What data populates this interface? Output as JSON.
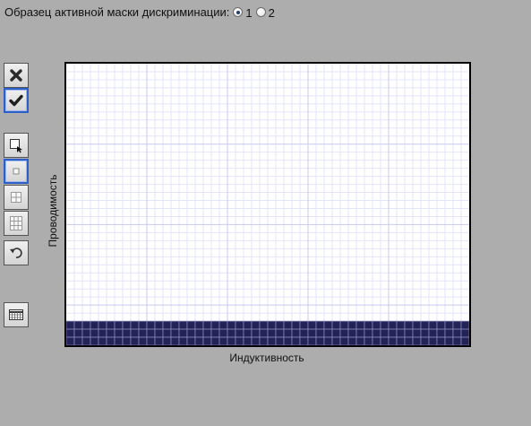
{
  "header": {
    "label": "Образец активной маски дискриминации:",
    "options": [
      {
        "label": "1",
        "checked": true
      },
      {
        "label": "2",
        "checked": false
      }
    ]
  },
  "toolbar": {
    "tools": [
      {
        "name": "delete-tool",
        "icon": "x-icon",
        "active": false
      },
      {
        "name": "apply-tool",
        "icon": "checkmark-icon",
        "active": true
      },
      {
        "name": "select-tool",
        "icon": "pointer-select-icon",
        "active": false
      },
      {
        "name": "brush-1x1-tool",
        "icon": "single-cell-icon",
        "active": true
      },
      {
        "name": "brush-2x2-tool",
        "icon": "four-cell-icon",
        "active": false
      },
      {
        "name": "brush-3x3-tool",
        "icon": "nine-cell-icon",
        "active": false
      },
      {
        "name": "undo-tool",
        "icon": "undo-icon",
        "active": false
      },
      {
        "name": "grid-toggle-tool",
        "icon": "grid-icon",
        "active": false
      }
    ]
  },
  "chart": {
    "xlabel": "Индуктивность",
    "ylabel": "Проводимость",
    "columns": 50,
    "rows": 35,
    "filled_rows": 3,
    "grid_minor_color": "#e4e4f8",
    "grid_major_color": "#c9c9ee",
    "fill_color": "#232357"
  }
}
